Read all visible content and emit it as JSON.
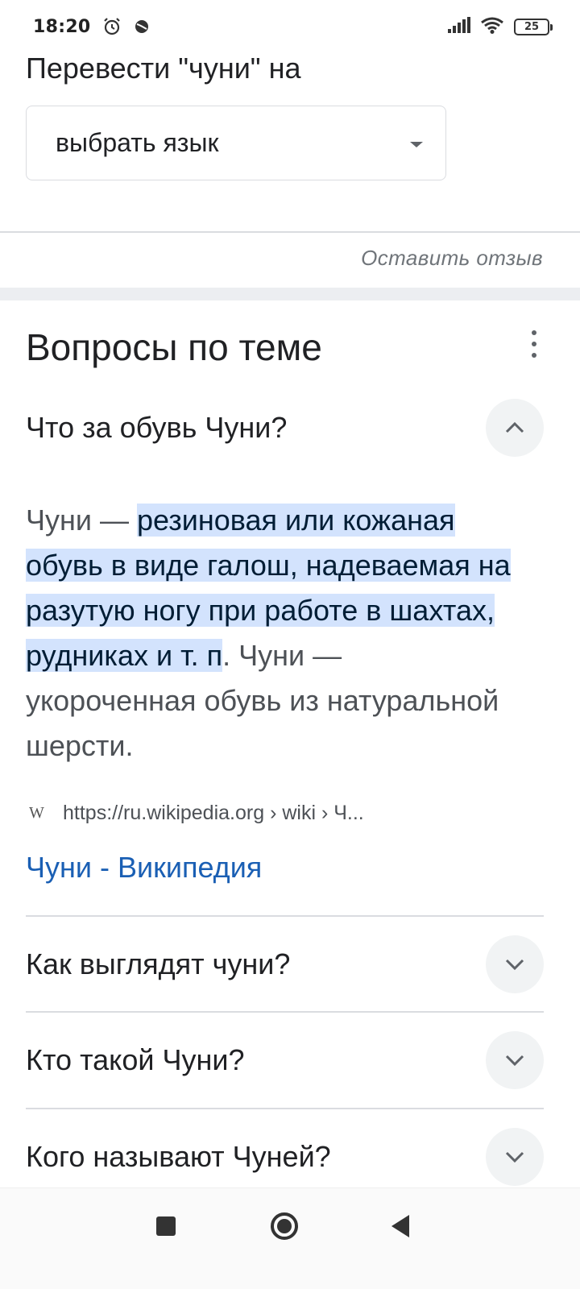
{
  "status_bar": {
    "time": "18:20",
    "battery": "25",
    "icons": [
      "alarm-icon",
      "app-notification-icon",
      "signal-icon",
      "wifi-icon",
      "battery-icon"
    ]
  },
  "translate": {
    "title": "Перевести \"чуни\" на",
    "select_value": "выбрать язык"
  },
  "feedback": {
    "label": "Оставить отзыв"
  },
  "related_questions": {
    "title": "Вопросы по теме",
    "items": [
      {
        "question": "Что за обувь Чуни?",
        "expanded": true,
        "answer": {
          "intro": "Чуни — ",
          "highlight_1": "резиновая или кожаная",
          "highlight_2": "обувь в виде галош, надеваемая на",
          "highlight_3": "разутую ногу при работе в шахтах,",
          "highlight_4": "рудниках и т. п",
          "rest_1": ". Чуни —",
          "rest_2": "укороченная обувь из натуральной",
          "rest_3": "шерсти."
        },
        "source": {
          "icon_letter": "W",
          "url": "https://ru.wikipedia.org › wiki › Ч...",
          "link_title": "Чуни - Википедия"
        }
      },
      {
        "question": "Как выглядят чуни?",
        "expanded": false
      },
      {
        "question": "Кто такой Чуни?",
        "expanded": false
      },
      {
        "question": "Кого называют Чуней?",
        "expanded": false
      }
    ]
  },
  "colors": {
    "link": "#1a5fb4",
    "highlight": "#d3e3fd",
    "divider": "#dadce0",
    "button_bg": "#f1f3f4"
  }
}
